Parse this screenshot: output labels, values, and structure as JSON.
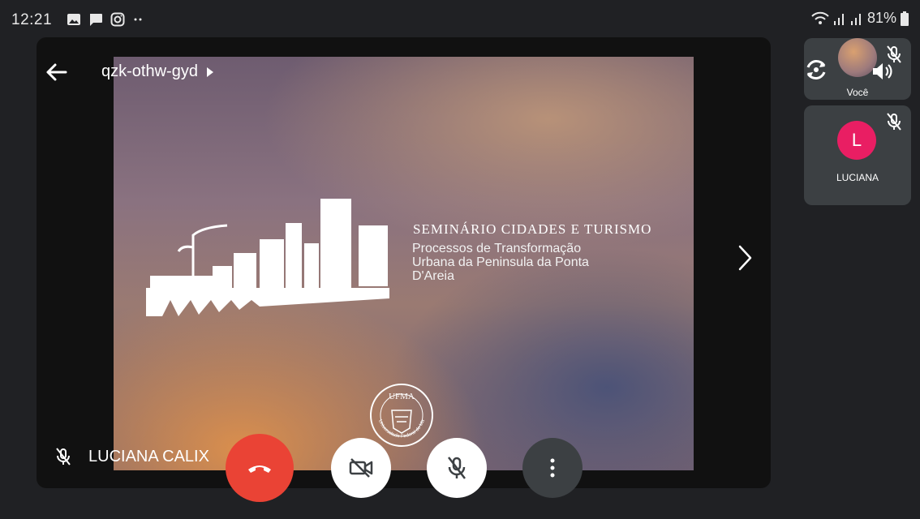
{
  "status_bar": {
    "time": "12:21",
    "battery": "81%",
    "icons": [
      "gallery-icon",
      "message-icon",
      "instagram-icon",
      "more-dots-icon",
      "wifi-icon",
      "signal-icon",
      "signal-icon",
      "battery-icon"
    ]
  },
  "meeting": {
    "code": "qzk-othw-gyd"
  },
  "slide": {
    "title": "SEMINÁRIO CIDADES E TURISMO",
    "subtitle_lines": [
      "Processos de Transformação",
      "Urbana da Peninsula da Ponta",
      "D'Areia"
    ],
    "seal_text": "UFMA",
    "seal_ring_text": "Universidade Federal do Maranhão"
  },
  "presenter": {
    "name": "LUCIANA CALIXTO CARVALHO",
    "name_visible": "LUCIANA CALIX"
  },
  "participants": [
    {
      "label": "Você",
      "avatar": "photo",
      "muted": true
    },
    {
      "label": "LUCIANA",
      "initial": "L",
      "avatar_color": "#e91e63",
      "muted": true
    }
  ],
  "controls": {
    "end_call_color": "#ea4335",
    "camera": "camera-off",
    "mic": "mic-off",
    "more": "more-vert"
  }
}
